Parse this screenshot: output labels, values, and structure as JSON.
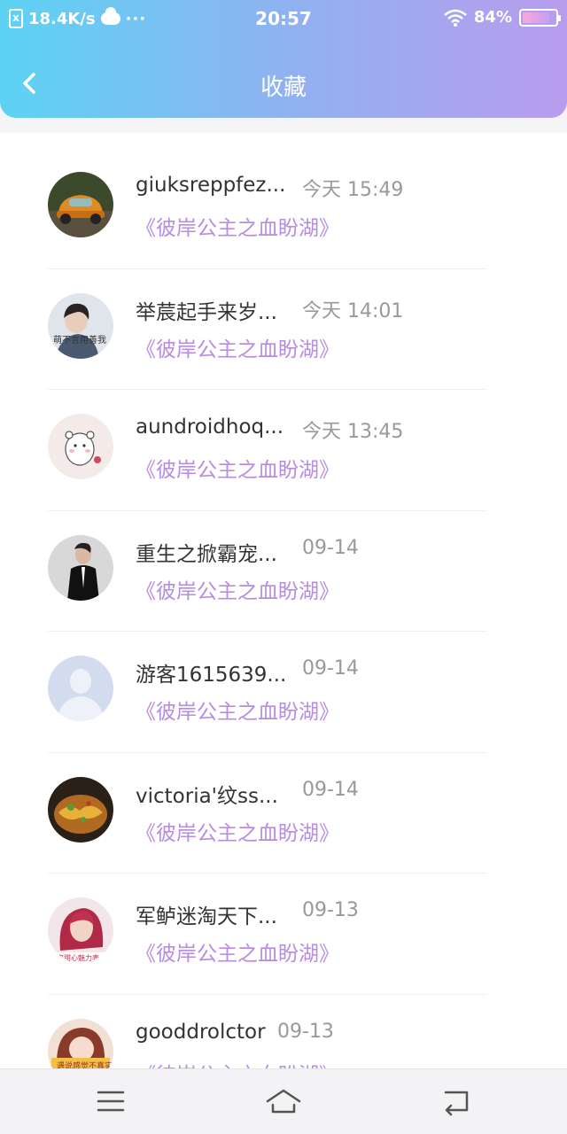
{
  "status_bar": {
    "speed": "18.4K/s",
    "time": "20:57",
    "battery": "84%"
  },
  "header": {
    "title": "收藏"
  },
  "favorites": [
    {
      "name": "giuksreppfez...",
      "time": "今天 15:49",
      "book": "《彼岸公主之血盼湖》",
      "avatar": "car-avatar"
    },
    {
      "name": "举莀起手来岁...",
      "time": "今天 14:01",
      "book": "《彼岸公主之血盼湖》",
      "avatar": "girl-avatar"
    },
    {
      "name": "aundroidhoq...",
      "time": "今天 13:45",
      "book": "《彼岸公主之血盼湖》",
      "avatar": "bear-avatar"
    },
    {
      "name": "重生之掀霸宠...",
      "time": "09-14",
      "book": "《彼岸公主之血盼湖》",
      "avatar": "man-avatar"
    },
    {
      "name": "游客1615639...",
      "time": "09-14",
      "book": "《彼岸公主之血盼湖》",
      "avatar": "default-avatar"
    },
    {
      "name": "victoria'纹ss...",
      "time": "09-14",
      "book": "《彼岸公主之血盼湖》",
      "avatar": "food-avatar"
    },
    {
      "name": "军鲈迷淘天下...",
      "time": "09-13",
      "book": "《彼岸公主之血盼湖》",
      "avatar": "woman-avatar"
    },
    {
      "name": "gooddrolctor",
      "time": "09-13",
      "book": "《彼岸公主之血盼湖》",
      "avatar": "anime-avatar"
    }
  ],
  "colors": {
    "accent": "#b88ce0",
    "header_start": "#5cd3f3",
    "header_end": "#b89cee"
  }
}
